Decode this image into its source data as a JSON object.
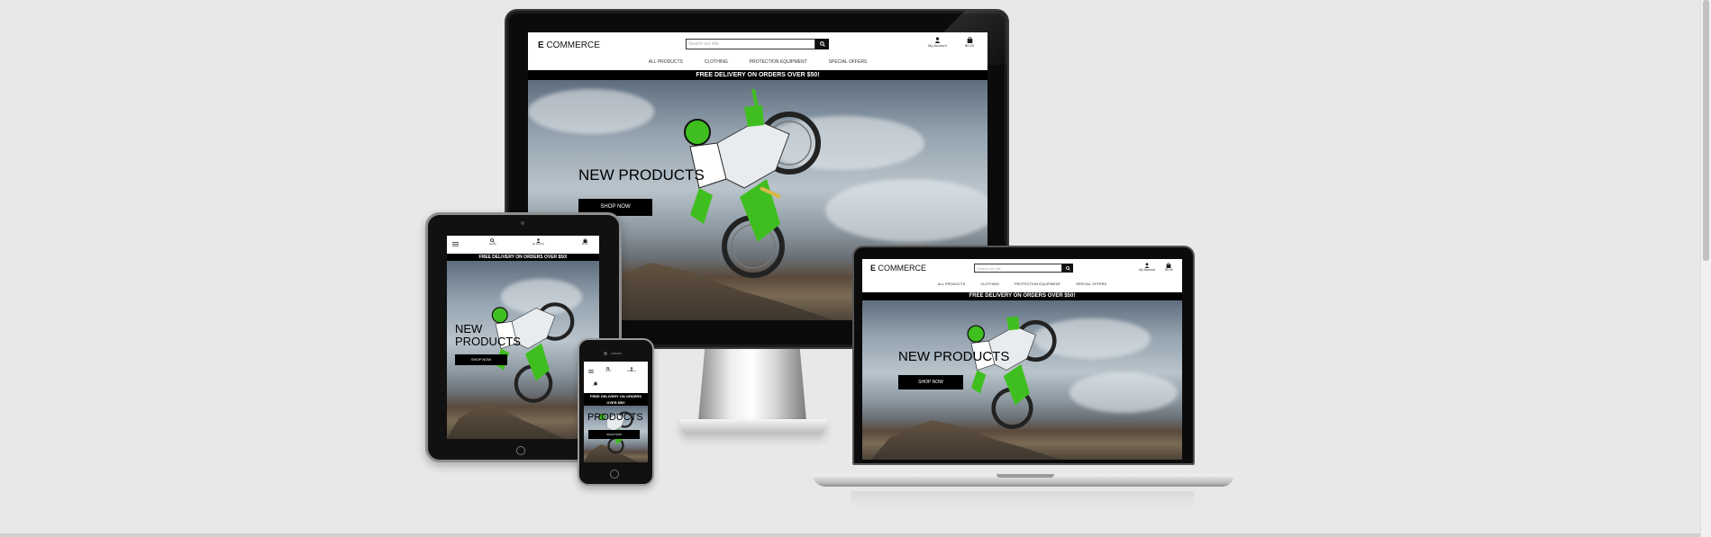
{
  "site": {
    "logo_prefix": "E",
    "logo_suffix": " COMMERCE",
    "search_placeholder": "Search our site",
    "account_label": "My Account",
    "bag_label": "$0.00",
    "search_icon_label": "Search",
    "nav": [
      "ALL PRODUCTS",
      "CLOTHING",
      "PROTECTION EQUIPMENT",
      "SPECIAL OFFERS"
    ],
    "banner_desktop": "FREE DELIVERY ON ORDERS OVER $50!",
    "banner_tablet": "FREE DELIVERY ON ORDERS OVER $50!",
    "banner_phone": "FREE DELIVERY ON ORDERS OVER $50!",
    "hero_title": "NEW PRODUCTS",
    "hero_title_tablet_line1": "NEW",
    "hero_title_tablet_line2": "PRODUCTS",
    "hero_title_phone": "PRODUCTS",
    "shop_button": "SHOP NOW"
  },
  "colors": {
    "background": "#e8e8e8",
    "banner": "#000000",
    "bike_green": "#3fbf1f"
  }
}
